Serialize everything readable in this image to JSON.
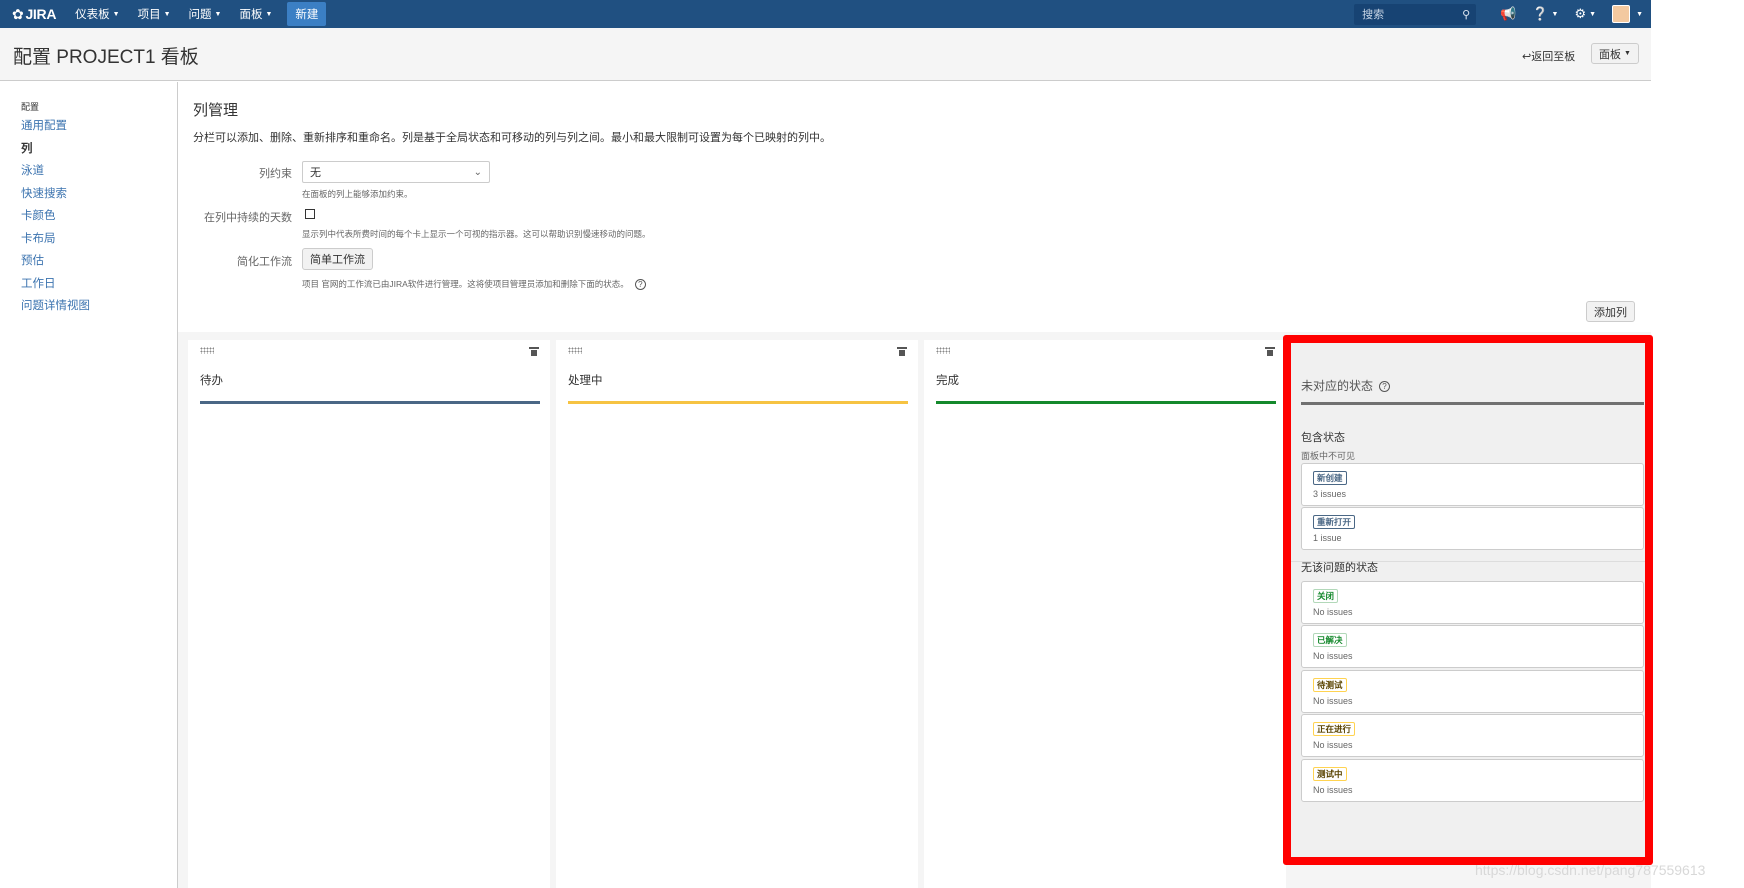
{
  "topnav": {
    "logo": "JIRA",
    "menus": [
      "仪表板",
      "项目",
      "问题",
      "面板"
    ],
    "create_label": "新建",
    "search_placeholder": "搜索",
    "brand_color": "#205081"
  },
  "header": {
    "title": "配置 PROJECT1 看板",
    "back_label": "返回至板",
    "board_menu": "面板"
  },
  "sidebar": {
    "heading": "配置",
    "items": [
      {
        "label": "通用配置",
        "active": false
      },
      {
        "label": "列",
        "active": true
      },
      {
        "label": "泳道",
        "active": false
      },
      {
        "label": "快速搜索",
        "active": false
      },
      {
        "label": "卡颜色",
        "active": false
      },
      {
        "label": "卡布局",
        "active": false
      },
      {
        "label": "预估",
        "active": false
      },
      {
        "label": "工作日",
        "active": false
      },
      {
        "label": "问题详情视图",
        "active": false
      }
    ]
  },
  "main": {
    "title": "列管理",
    "description": "分栏可以添加、删除、重新排序和重命名。列是基于全局状态和可移动的列与列之间。最小和最大限制可设置为每个已映射的列中。",
    "constraint_label": "列约束",
    "constraint_value": "无",
    "constraint_hint": "在面板的列上能够添加约束。",
    "days_label": "在列中持续的天数",
    "days_hint": "显示列中代表所费时间的每个卡上显示一个可视的指示器。这可以帮助识别慢速移动的问题。",
    "simplify_label": "简化工作流",
    "simplify_button": "简单工作流",
    "simplify_hint": "项目 官网的工作流已由JIRA软件进行管理。这将使项目管理员添加和删除下面的状态。",
    "add_column": "添加列"
  },
  "columns": [
    {
      "name": "待办",
      "color": "#4a6785"
    },
    {
      "name": "处理中",
      "color": "#f6c342"
    },
    {
      "name": "完成",
      "color": "#14892c"
    }
  ],
  "unmapped": {
    "title": "未对应的状态",
    "with_issues_heading": "包含状态",
    "with_issues_note": "面板中不可见",
    "with_issues": [
      {
        "status": "新创建",
        "count": "3 issues",
        "style": "blue"
      },
      {
        "status": "重新打开",
        "count": "1 issue",
        "style": "blue"
      }
    ],
    "no_issues_heading": "无该问题的状态",
    "no_issues": [
      {
        "status": "关闭",
        "count": "No issues",
        "style": "green"
      },
      {
        "status": "已解决",
        "count": "No issues",
        "style": "green"
      },
      {
        "status": "待测试",
        "count": "No issues",
        "style": "yellow"
      },
      {
        "status": "正在进行",
        "count": "No issues",
        "style": "yellow"
      },
      {
        "status": "测试中",
        "count": "No issues",
        "style": "yellow"
      }
    ],
    "highlight_color": "#ff0000"
  },
  "watermark": "https://blog.csdn.net/pang787559613"
}
